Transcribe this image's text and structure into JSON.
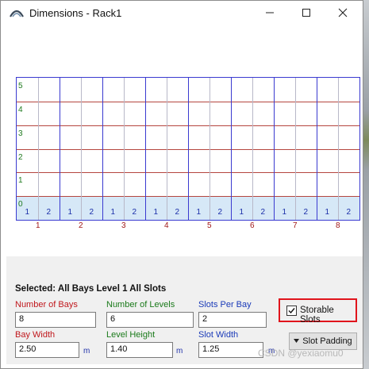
{
  "window": {
    "title": "Dimensions - Rack1",
    "icon": "rack-arc-icon",
    "controls": {
      "minimize": "minimize-icon",
      "maximize": "maximize-icon",
      "close": "close-icon"
    }
  },
  "grid": {
    "levels": [
      "0",
      "1",
      "2",
      "3",
      "4",
      "5"
    ],
    "bays": [
      "1",
      "2",
      "3",
      "4",
      "5",
      "6",
      "7",
      "8"
    ],
    "slots_per_bay": [
      "1",
      "2"
    ],
    "colors": {
      "bay_line": "#3a3ad0",
      "level_line": "#b5463f",
      "selected_band": "#d6e8f7",
      "level_label": "#1f7a1f",
      "bay_label": "#a01818",
      "slot_label": "#1a2ea8"
    }
  },
  "panel": {
    "selected_text": "Selected: All Bays Level 1 All Slots",
    "number_of_bays": {
      "label": "Number of Bays",
      "value": "8"
    },
    "number_of_levels": {
      "label": "Number of Levels",
      "value": "6"
    },
    "slots_per_bay": {
      "label": "Slots Per Bay",
      "value": "2"
    },
    "storable_slots": {
      "label": "Storable Slots",
      "checked": true
    },
    "bay_width": {
      "label": "Bay Width",
      "value": "2.50",
      "unit": "m"
    },
    "level_height": {
      "label": "Level Height",
      "value": "1.40",
      "unit": "m"
    },
    "slot_width": {
      "label": "Slot Width",
      "value": "1.25",
      "unit": "m"
    },
    "slot_padding": {
      "label": "Slot Padding",
      "icon": "dropdown-triangle-icon"
    }
  },
  "watermark": "CSDN @yexiaomu0"
}
